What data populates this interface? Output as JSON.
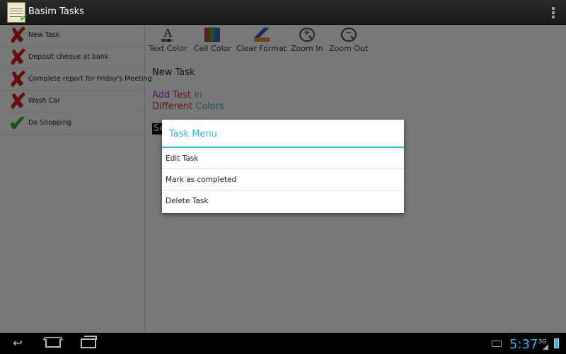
{
  "app": {
    "title": "Basim Tasks"
  },
  "tasks": [
    {
      "label": "New Task",
      "status": "incomplete"
    },
    {
      "label": "Deposit cheque at bank",
      "status": "incomplete"
    },
    {
      "label": "Complete report for Friday's Meeting",
      "status": "incomplete"
    },
    {
      "label": "Wash Car",
      "status": "incomplete"
    },
    {
      "label": "Do Shopping",
      "status": "complete"
    }
  ],
  "toolbar": {
    "text_color": "Text Color",
    "cell_color": "Cell Color",
    "clear_format": "Clear Format",
    "zoom_in": "Zoom In",
    "zoom_out": "Zoom Out"
  },
  "document": {
    "title": "New Task",
    "line1": {
      "a": "Add",
      "b": "Test",
      "c": "in"
    },
    "line2": {
      "a": "Different",
      "b": "Colors"
    },
    "selected_fragment": "Se"
  },
  "dialog": {
    "title": "Task Menu",
    "items": [
      "Edit Task",
      "Mark as completed",
      "Delete Task"
    ]
  },
  "status_bar": {
    "time": "5:37",
    "network": "3G"
  },
  "colors": {
    "accent": "#33b5e5",
    "purple": "#9b30c8",
    "red": "#c83030",
    "green": "#2eaa2e",
    "teal": "#26b0b8"
  }
}
